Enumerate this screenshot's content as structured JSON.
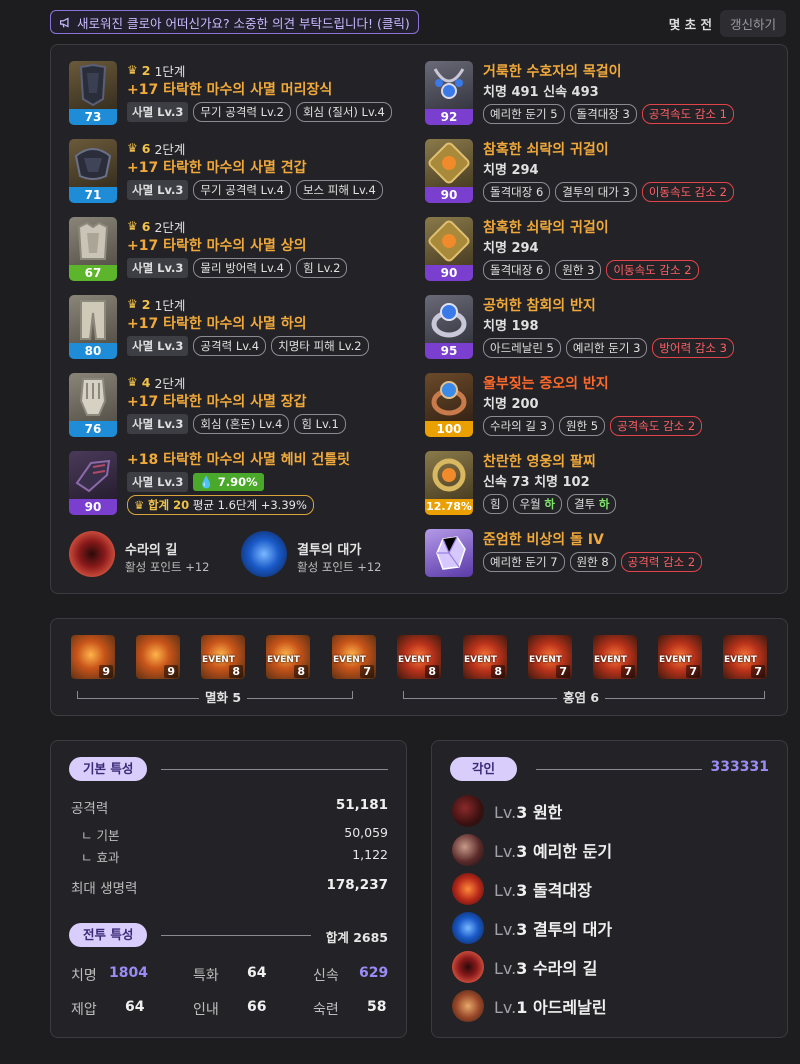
{
  "topbar": {
    "feedback": "새로워진 클로아 어떠신가요? 소중한 의견 부탁드립니다! (클릭)",
    "updated_ago": "몇 초 전",
    "refresh": "갱신하기"
  },
  "armor": [
    {
      "quality": "73",
      "tier_count": "2",
      "tier": "1단계",
      "name": "+17 타락한 마수의 사멸 머리장식",
      "set": "사멸 Lv.3",
      "effects": [
        "무기 공격력 Lv.2",
        "회심 (질서) Lv.4"
      ]
    },
    {
      "quality": "71",
      "tier_count": "6",
      "tier": "2단계",
      "name": "+17 타락한 마수의 사멸 견갑",
      "set": "사멸 Lv.3",
      "effects": [
        "무기 공격력 Lv.4",
        "보스 피해 Lv.4"
      ]
    },
    {
      "quality": "67",
      "tier_count": "6",
      "tier": "2단계",
      "name": "+17 타락한 마수의 사멸 상의",
      "set": "사멸 Lv.3",
      "effects": [
        "물리 방어력 Lv.4",
        "힘 Lv.2"
      ]
    },
    {
      "quality": "80",
      "tier_count": "2",
      "tier": "1단계",
      "name": "+17 타락한 마수의 사멸 하의",
      "set": "사멸 Lv.3",
      "effects": [
        "공격력 Lv.4",
        "치명타 피해 Lv.2"
      ]
    },
    {
      "quality": "76",
      "tier_count": "4",
      "tier": "2단계",
      "name": "+17 타락한 마수의 사멸 장갑",
      "set": "사멸 Lv.3",
      "effects": [
        "회심 (혼돈) Lv.4",
        "힘 Lv.1"
      ]
    }
  ],
  "weapon": {
    "quality": "90",
    "name": "+18 타락한 마수의 사멸 헤비 건틀릿",
    "set": "사멸 Lv.3",
    "bonus": "7.90%",
    "sum_label": "합계 20",
    "avg_label": "평균 1.6단계 +3.39%"
  },
  "books": [
    {
      "title": "수라의 길",
      "sub": "활성 포인트 +12"
    },
    {
      "title": "결투의 대가",
      "sub": "활성 포인트 +12"
    }
  ],
  "accessories": [
    {
      "quality": "92",
      "name": "거룩한 수호자의 목걸이",
      "stats": "치명 491  신속 493",
      "effects": [
        "예리한 둔기 5",
        "돌격대장 3"
      ],
      "penalty": "공격속도 감소 1"
    },
    {
      "quality": "90",
      "name": "참혹한 쇠락의 귀걸이",
      "stats": "치명 294",
      "effects": [
        "돌격대장 6",
        "결투의 대가 3"
      ],
      "penalty": "이동속도 감소 2"
    },
    {
      "quality": "90",
      "name": "참혹한 쇠락의 귀걸이",
      "stats": "치명 294",
      "effects": [
        "돌격대장 6",
        "원한 3"
      ],
      "penalty": "이동속도 감소 2"
    },
    {
      "quality": "95",
      "name": "공허한 참회의 반지",
      "stats": "치명 198",
      "effects": [
        "아드레날린 5",
        "예리한 둔기 3"
      ],
      "penalty": "방어력 감소 3"
    },
    {
      "quality": "100",
      "name": "울부짖는 증오의 반지",
      "stats": "치명 200",
      "effects": [
        "수라의 길 3",
        "원한 5"
      ],
      "penalty": "공격속도 감소 2"
    }
  ],
  "bracelet": {
    "quality": "12.78%",
    "name": "찬란한 영웅의 팔찌",
    "stats": "신속 73  치명 102",
    "effects": [
      "힘",
      "우월",
      "결투"
    ],
    "grade": "하"
  },
  "stone": {
    "name": "준엄한 비상의 돌 IV",
    "effects": [
      "예리한 둔기 7",
      "원한 8"
    ],
    "penalty": "공격력 감소 2"
  },
  "gems": {
    "items": [
      {
        "level": "9",
        "event": ""
      },
      {
        "level": "9",
        "event": ""
      },
      {
        "level": "8",
        "event": "EVENT"
      },
      {
        "level": "8",
        "event": "EVENT"
      },
      {
        "level": "7",
        "event": "EVENT"
      },
      {
        "level": "8",
        "event": "EVENT"
      },
      {
        "level": "8",
        "event": "EVENT"
      },
      {
        "level": "7",
        "event": "EVENT"
      },
      {
        "level": "7",
        "event": "EVENT"
      },
      {
        "level": "7",
        "event": "EVENT"
      },
      {
        "level": "7",
        "event": "EVENT"
      }
    ],
    "group1": "멸화 5",
    "group2": "홍염 6"
  },
  "basic_stats": {
    "title": "기본 특성",
    "attack_label": "공격력",
    "attack": "51,181",
    "base_label": "ㄴ 기본",
    "base": "50,059",
    "effect_label": "ㄴ 효과",
    "effect": "1,122",
    "hp_label": "최대 생명력",
    "hp": "178,237"
  },
  "combat_stats": {
    "title": "전투 특성",
    "total": "합계 2685",
    "items": [
      {
        "label": "치명",
        "value": "1804"
      },
      {
        "label": "특화",
        "value": "64"
      },
      {
        "label": "신속",
        "value": "629"
      },
      {
        "label": "제압",
        "value": "64"
      },
      {
        "label": "인내",
        "value": "66"
      },
      {
        "label": "숙련",
        "value": "58"
      }
    ]
  },
  "engravings": {
    "title": "각인",
    "code": "333331",
    "items": [
      {
        "lv": "Lv.",
        "num": "3",
        "name": "원한"
      },
      {
        "lv": "Lv.",
        "num": "3",
        "name": "예리한 둔기"
      },
      {
        "lv": "Lv.",
        "num": "3",
        "name": "돌격대장"
      },
      {
        "lv": "Lv.",
        "num": "3",
        "name": "결투의 대가"
      },
      {
        "lv": "Lv.",
        "num": "3",
        "name": "수라의 길"
      },
      {
        "lv": "Lv.",
        "num": "1",
        "name": "아드레날린"
      }
    ]
  },
  "colors": {
    "accent_purple": "#9b8cf5",
    "item_name_gold": "#f0a93a",
    "penalty_red": "#ff5f64",
    "panel_bg": "#232327"
  }
}
